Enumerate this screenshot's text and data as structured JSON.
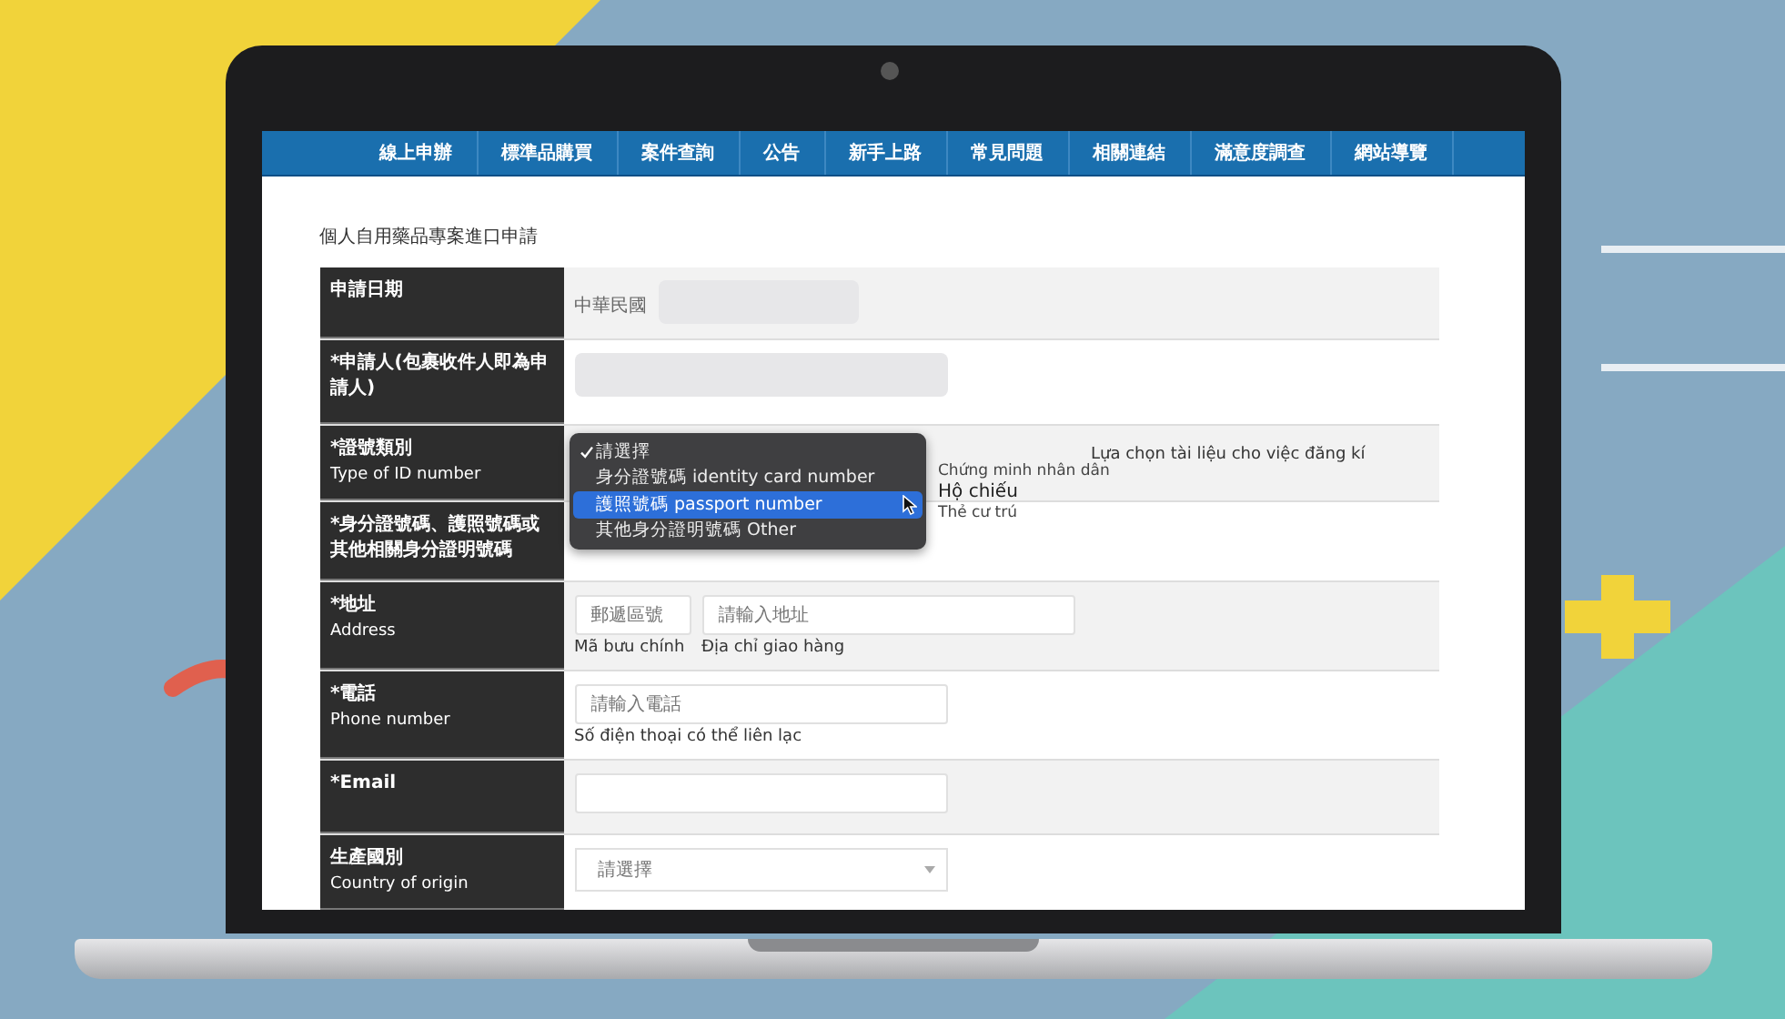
{
  "nav": [
    {
      "label": "線上申辦"
    },
    {
      "label": "標準品購買"
    },
    {
      "label": "案件查詢"
    },
    {
      "label": "公告"
    },
    {
      "label": "新手上路"
    },
    {
      "label": "常見問題"
    },
    {
      "label": "相關連結"
    },
    {
      "label": "滿意度調查"
    },
    {
      "label": "網站導覽"
    }
  ],
  "page_title": "個人自用藥品專案進口申請",
  "form": {
    "rows": [
      {
        "kind": "readonly",
        "label": "申請日期",
        "prefix": "中華民國"
      },
      {
        "kind": "readonly",
        "label": "*申請人(包裹收件人即為申請人)"
      },
      {
        "kind": "select_open",
        "label": "*證號類別",
        "label_en": "Type of ID number",
        "side_note": "Lựa chọn tài liệu cho việc đăng kí"
      },
      {
        "kind": "blank",
        "label": "*身分證號碼、護照號碼或其他相關身分證明號碼"
      },
      {
        "kind": "fields",
        "label": "*地址",
        "label_en": "Address",
        "fields": [
          {
            "placeholder": "郵遞區號",
            "note": "Mã bưu chính"
          },
          {
            "placeholder": "請輸入地址",
            "note": "Địa chỉ giao hàng"
          }
        ]
      },
      {
        "kind": "fields",
        "label": "*電話",
        "label_en": "Phone number",
        "fields": [
          {
            "placeholder": "請輸入電話",
            "note": "Số điện thoại có thể liên lạc"
          }
        ]
      },
      {
        "kind": "empty_field",
        "label": "*Email"
      },
      {
        "kind": "select",
        "label": "生產國別",
        "label_en": "Country of origin",
        "value": "請選擇"
      }
    ]
  },
  "dropdown": {
    "options": [
      {
        "label": "請選擇",
        "checked": true,
        "selected": false
      },
      {
        "label": "身分證號碼 identity card number",
        "checked": false,
        "selected": false,
        "note": "Chứng minh nhân dân"
      },
      {
        "label": "護照號碼 passport number",
        "checked": false,
        "selected": true,
        "note": "Hộ chiếu"
      },
      {
        "label": "其他身分證明號碼 Other",
        "checked": false,
        "selected": false,
        "note": "Thẻ cư trú"
      }
    ]
  }
}
